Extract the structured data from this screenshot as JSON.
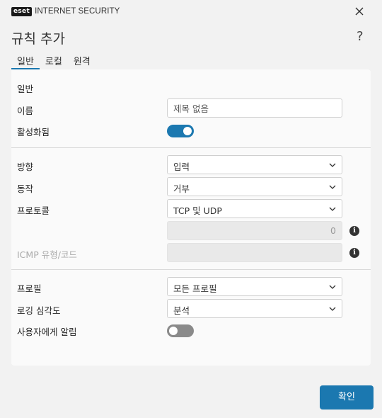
{
  "titlebar": {
    "brand": "eset",
    "product": "INTERNET SECURITY",
    "close_icon": "close-icon"
  },
  "dialog": {
    "title": "규칙 추가",
    "help_label": "?"
  },
  "tabs": [
    {
      "label": "일반",
      "active": true
    },
    {
      "label": "로컬",
      "active": false
    },
    {
      "label": "원격",
      "active": false
    }
  ],
  "general": {
    "section_title": "일반",
    "name_label": "이름",
    "name_placeholder": "제목 없음",
    "enabled_label": "활성화됨",
    "enabled": true
  },
  "rule": {
    "direction_label": "방향",
    "direction_value": "입력",
    "action_label": "동작",
    "action_value": "거부",
    "protocol_label": "프로토콜",
    "protocol_value": "TCP 및 UDP",
    "protocol_number": "0",
    "icmp_label": "ICMP 유형/코드",
    "icmp_value": ""
  },
  "profile": {
    "profile_label": "프로필",
    "profile_value": "모든 프로필",
    "log_label": "로깅 심각도",
    "log_value": "분석",
    "notify_label": "사용자에게 알림",
    "notify": false
  },
  "footer": {
    "ok_label": "확인"
  },
  "colors": {
    "accent": "#1b78b0",
    "background": "#f2f2f2",
    "panel": "#fafafa"
  }
}
